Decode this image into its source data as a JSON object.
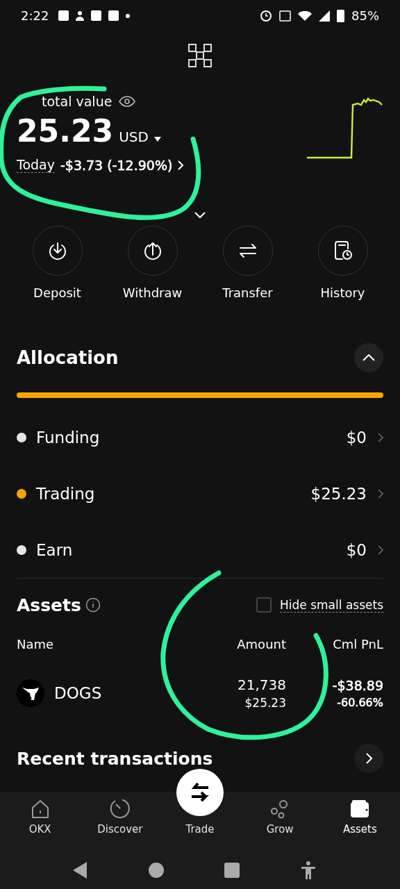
{
  "status_bar": {
    "time": "2:22",
    "battery": "85%"
  },
  "summary": {
    "label": "total value",
    "amount": "25.23",
    "currency": "USD",
    "today_label": "Today",
    "change": "-$3.73 (-12.90%)"
  },
  "actions": [
    {
      "kind": "deposit",
      "label": "Deposit"
    },
    {
      "kind": "withdraw",
      "label": "Withdraw"
    },
    {
      "kind": "transfer",
      "label": "Transfer"
    },
    {
      "kind": "history",
      "label": "History"
    }
  ],
  "allocation": {
    "title": "Allocation",
    "expanded": true,
    "items": [
      {
        "name": "Funding",
        "value": "$0",
        "color": "#e6e6e6"
      },
      {
        "name": "Trading",
        "value": "$25.23",
        "color": "#f7a600"
      },
      {
        "name": "Earn",
        "value": "$0",
        "color": "#e6e6e6"
      }
    ]
  },
  "assets": {
    "title": "Assets",
    "hide_small": {
      "label": "Hide small assets",
      "checked": false
    },
    "columns": [
      "Name",
      "Amount",
      "Cml PnL"
    ],
    "rows": [
      {
        "name": "DOGS",
        "amount": "21,738",
        "value": "$25.23",
        "pnl": "-$38.89",
        "pnl_pct": "-60.66%"
      }
    ]
  },
  "recent": {
    "title": "Recent transactions"
  },
  "nav": [
    {
      "kind": "home",
      "label": "OKX",
      "selected": false
    },
    {
      "kind": "discover",
      "label": "Discover",
      "selected": false
    },
    {
      "kind": "trade",
      "label": "Trade",
      "selected": false
    },
    {
      "kind": "grow",
      "label": "Grow",
      "selected": false
    },
    {
      "kind": "wallet",
      "label": "Assets",
      "selected": true
    }
  ]
}
